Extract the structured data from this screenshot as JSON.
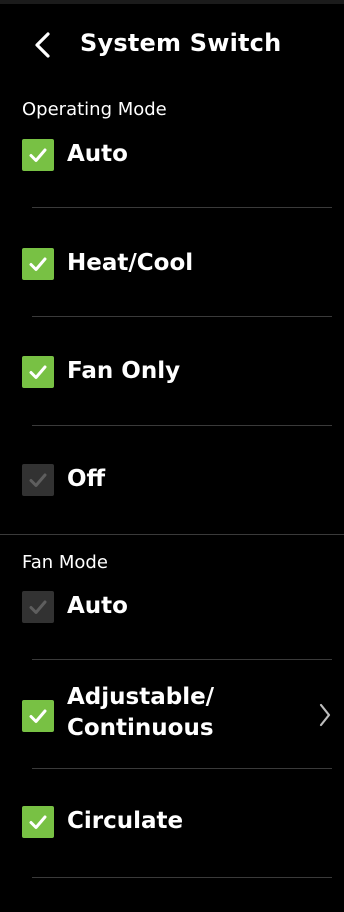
{
  "header": {
    "title": "System Switch"
  },
  "operating_mode": {
    "label": "Operating Mode",
    "options": [
      {
        "label": "Auto",
        "checked": true
      },
      {
        "label": "Heat/Cool",
        "checked": true
      },
      {
        "label": "Fan Only",
        "checked": true
      },
      {
        "label": "Off",
        "checked": false
      }
    ]
  },
  "fan_mode": {
    "label": "Fan Mode",
    "options": [
      {
        "label": "Auto",
        "checked": false
      },
      {
        "label": "Adjustable/\nContinuous",
        "checked": true,
        "has_submenu": true
      },
      {
        "label": "Circulate",
        "checked": true
      }
    ]
  },
  "colors": {
    "background": "#000000",
    "checked": "#78c144",
    "unchecked": "#323232",
    "divider": "#3a3a3a",
    "text": "#ffffff"
  },
  "icons": {
    "back": "chevron-left-icon",
    "check": "check-icon",
    "submenu": "chevron-right-icon"
  }
}
